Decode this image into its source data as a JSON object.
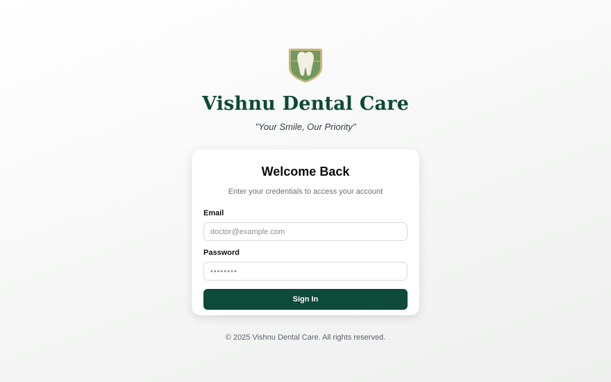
{
  "brand": {
    "logo_icon": "tooth-shield-icon",
    "title": "Vishnu Dental Care",
    "tagline": "\"Your Smile, Our Priority\"",
    "primary_color": "#0d4a3a",
    "logo_green": "#6e9a5c",
    "logo_gold": "#c7b27a"
  },
  "login": {
    "title": "Welcome Back",
    "subtitle": "Enter your credentials to access your account",
    "email_label": "Email",
    "email_placeholder": "doctor@example.com",
    "email_value": "",
    "password_label": "Password",
    "password_placeholder": "••••••••",
    "password_value": "",
    "submit_label": "Sign In"
  },
  "footer": {
    "text": "© 2025 Vishnu Dental Care. All rights reserved."
  }
}
